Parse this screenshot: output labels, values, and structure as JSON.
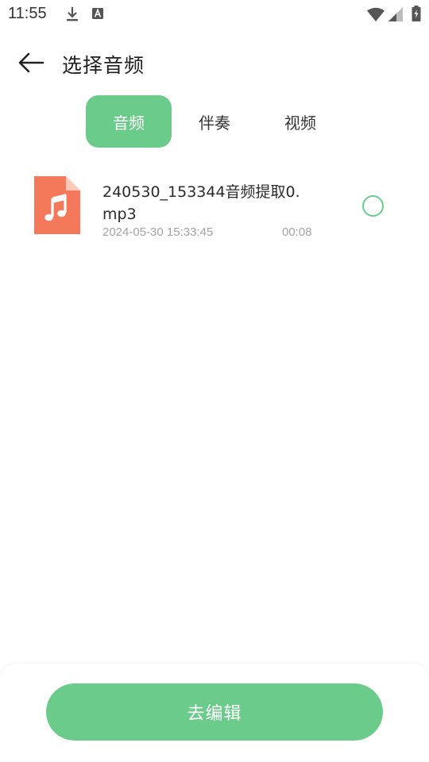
{
  "status_bar": {
    "time": "11:55",
    "icons": [
      "download-icon",
      "a-icon",
      "wifi-icon",
      "signal-icon",
      "battery-charging-icon"
    ]
  },
  "header": {
    "back_icon": "arrow-left-icon",
    "title": "选择音频"
  },
  "tabs": [
    {
      "label": "音频",
      "active": true
    },
    {
      "label": "伴奏",
      "active": false
    },
    {
      "label": "视频",
      "active": false
    }
  ],
  "files": [
    {
      "name": "240530_153344音频提取0.mp3",
      "date": "2024-05-30 15:33:45",
      "duration": "00:08",
      "icon": "music-file-icon",
      "selected": false
    }
  ],
  "footer": {
    "edit_label": "去编辑"
  },
  "colors": {
    "accent": "#6bcb8b",
    "file_icon": "#f4785a",
    "file_icon_fold": "#fbc9ba",
    "secondary_text": "#a3a3a3"
  }
}
